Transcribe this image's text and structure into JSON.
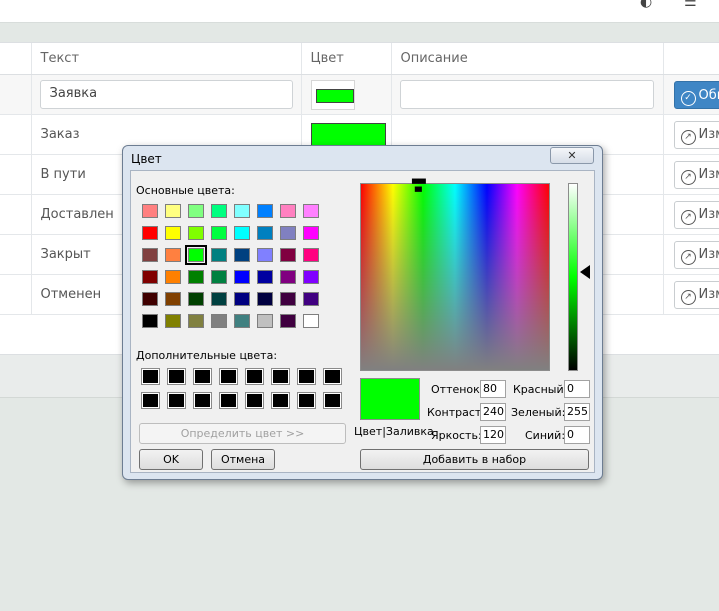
{
  "table": {
    "columns": [
      "Текст",
      "Цвет",
      "Описание"
    ],
    "edit_row": {
      "text_value": "Заявка",
      "description_value": "",
      "swatch_color": "#00ff00",
      "update_label": "Обн"
    },
    "rows": [
      {
        "text": "Заказ",
        "color": "#00ff00",
        "action_label": "Изм"
      },
      {
        "text": "В пути",
        "color": "#00ff00",
        "action_label": "Изм"
      },
      {
        "text": "Доставлен",
        "color": "",
        "action_label": "Изм"
      },
      {
        "text": "Закрыт",
        "color": "",
        "action_label": "Изм"
      },
      {
        "text": "Отменен",
        "color": "",
        "action_label": "Изм"
      }
    ]
  },
  "dialog": {
    "title": "Цвет",
    "close_label": "✕",
    "basic_colors_label": "Основные цвета:",
    "custom_colors_label": "Дополнительные цвета:",
    "basic_colors": [
      [
        "#ff8080",
        "#ffff80",
        "#80ff80",
        "#00ff80",
        "#80ffff",
        "#0080ff",
        "#ff80c0",
        "#ff80ff"
      ],
      [
        "#ff0000",
        "#ffff00",
        "#80ff00",
        "#00ff40",
        "#00ffff",
        "#0080c0",
        "#8080c0",
        "#ff00ff"
      ],
      [
        "#804040",
        "#ff8040",
        "#00ff00",
        "#008080",
        "#004080",
        "#8080ff",
        "#800040",
        "#ff0080"
      ],
      [
        "#800000",
        "#ff8000",
        "#008000",
        "#008040",
        "#0000ff",
        "#0000a0",
        "#800080",
        "#8000ff"
      ],
      [
        "#400000",
        "#804000",
        "#004000",
        "#004040",
        "#000080",
        "#000040",
        "#400040",
        "#400080"
      ],
      [
        "#000000",
        "#808000",
        "#808040",
        "#808080",
        "#408080",
        "#c0c0c0",
        "#400040",
        "#ffffff"
      ]
    ],
    "selected_color": "#00ff00",
    "preview_label": "Цвет|Заливка",
    "hue_label": "Оттенок:",
    "hue": "80",
    "sat_label": "Контраст:",
    "sat": "240",
    "lum_label": "Яркость:",
    "lum": "120",
    "red_label": "Красный:",
    "red": "0",
    "green_label": "Зеленый:",
    "green": "255",
    "blue_label": "Синий:",
    "blue": "0",
    "define_label": "Определить цвет >>",
    "ok_label": "OK",
    "cancel_label": "Отмена",
    "add_label": "Добавить в набор"
  }
}
